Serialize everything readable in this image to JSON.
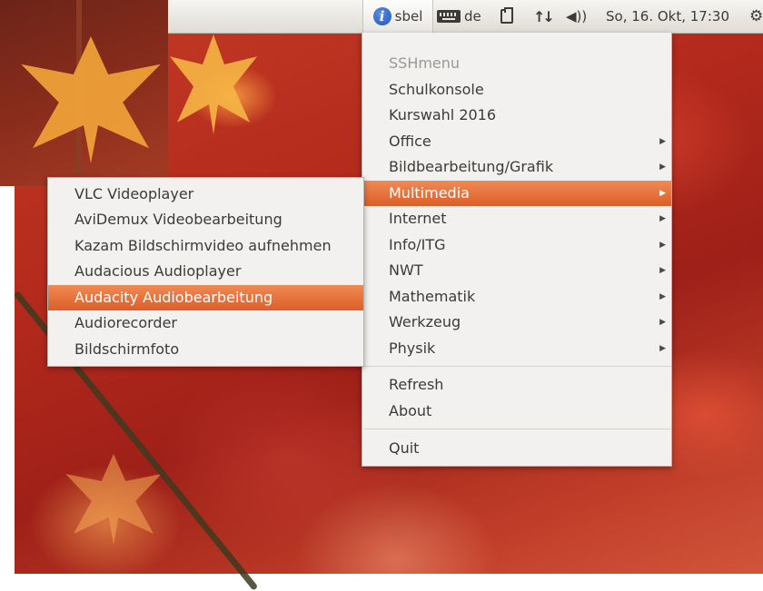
{
  "panel": {
    "ssh_label": "sbel",
    "keyboard_layout": "de",
    "clock": "So, 16. Okt, 17:30",
    "icons": {
      "indicator": "info-icon",
      "keyboard": "keyboard-icon",
      "clipboard": "clipboard-icon",
      "network": "network-arrows-icon",
      "volume": "volume-icon",
      "session": "gear-icon"
    }
  },
  "main_menu": {
    "title": "SSHmenu",
    "items": [
      {
        "label": "Schulkonsole",
        "submenu": false
      },
      {
        "label": "Kurswahl 2016",
        "submenu": false
      },
      {
        "label": "Office",
        "submenu": true
      },
      {
        "label": "Bildbearbeitung/Grafik",
        "submenu": true
      },
      {
        "label": "Multimedia",
        "submenu": true,
        "active": true
      },
      {
        "label": "Internet",
        "submenu": true
      },
      {
        "label": "Info/ITG",
        "submenu": true
      },
      {
        "label": "NWT",
        "submenu": true
      },
      {
        "label": "Mathematik",
        "submenu": true
      },
      {
        "label": "Werkzeug",
        "submenu": true
      },
      {
        "label": "Physik",
        "submenu": true
      }
    ],
    "refresh": "Refresh",
    "about": "About",
    "quit": "Quit"
  },
  "sub_menu": {
    "items": [
      {
        "label": "VLC Videoplayer"
      },
      {
        "label": "AviDemux Videobearbeitung"
      },
      {
        "label": "Kazam Bildschirmvideo aufnehmen"
      },
      {
        "label": "Audacious Audioplayer"
      },
      {
        "label": "Audacity Audiobearbeitung",
        "active": true
      },
      {
        "label": "Audiorecorder"
      },
      {
        "label": "Bildschirmfoto"
      }
    ]
  },
  "colors": {
    "highlight": "#e9733d",
    "panel": "#ecebe7",
    "menu": "#f2f1ef"
  }
}
